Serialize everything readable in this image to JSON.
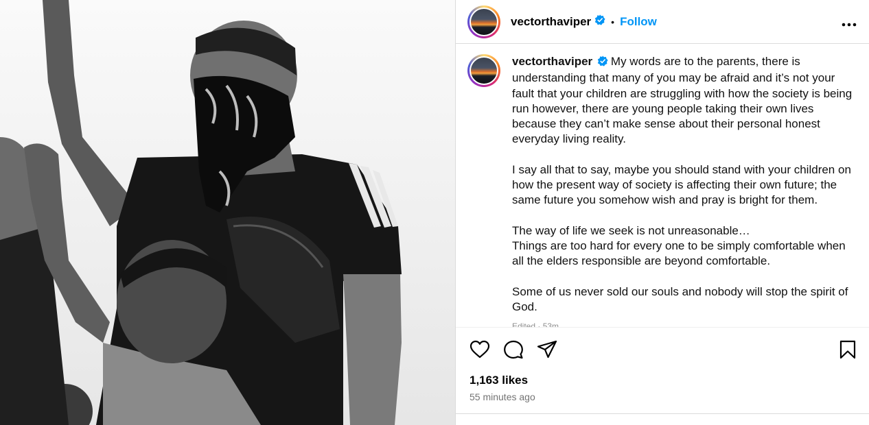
{
  "post": {
    "username": "vectorthaviper",
    "separator": "•",
    "follow_label": "Follow",
    "more_label": "•••",
    "caption_paragraphs": [
      "My words are to the parents, there is understanding that many of you may be afraid and it’s not your fault that your children are struggling with how the society is being run however, there are young people taking their own lives because they can’t make sense about their personal honest everyday living reality.",
      "I say all that to say, maybe you should stand with your children on how the present way of society is affecting their own future; the same future you somehow wish and pray is bright for them.",
      "The way of life we seek is not unreasonable…\nThings are too hard for every one to be simply comfortable when all the elders responsible are beyond comfortable.",
      "Some of us never sold our souls and nobody will stop the spirit of God."
    ],
    "edited_label": "Edited · 53m",
    "likes": "1,163 likes",
    "time_ago": "55 minutes ago"
  },
  "icons": {
    "like": "heart-icon",
    "comment": "comment-icon",
    "share": "share-icon",
    "save": "bookmark-icon",
    "verified": "verified-badge-icon"
  },
  "colors": {
    "follow": "#0095f6",
    "verified": "#0095f6",
    "muted": "#737373",
    "border": "#dbdbdb"
  }
}
